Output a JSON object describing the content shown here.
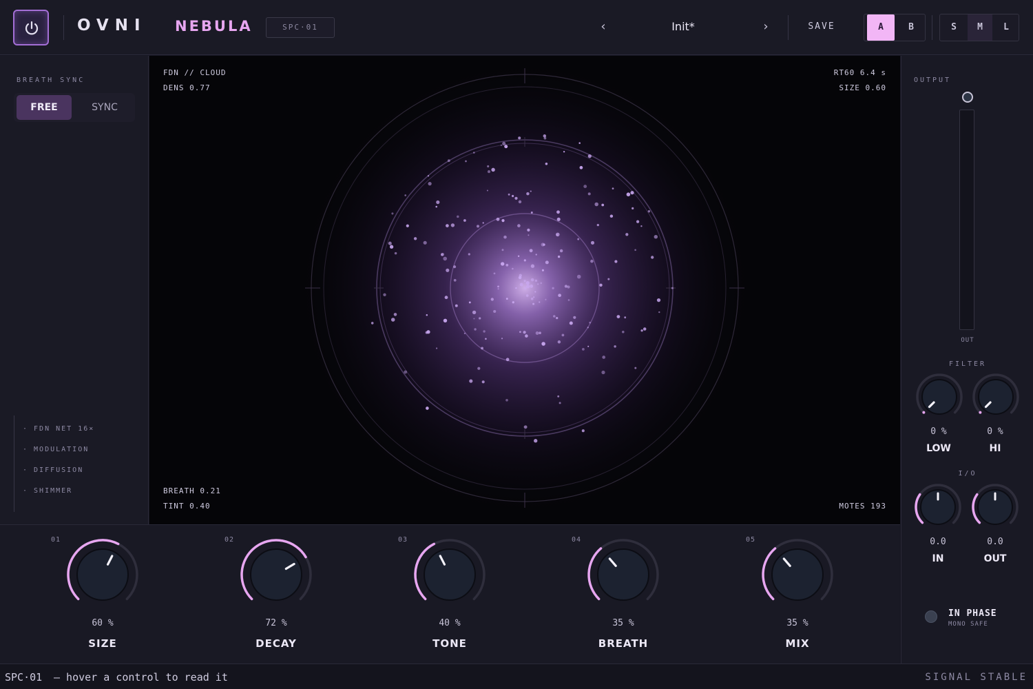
{
  "header": {
    "brand": "OVNI",
    "product": "NEBULA",
    "model": "SPC·01",
    "preset_prev": "‹",
    "preset_name": "Init*",
    "preset_next": "›",
    "save_label": "SAVE",
    "ab": [
      {
        "label": "A",
        "active": true
      },
      {
        "label": "B",
        "active": false
      }
    ],
    "sizes": [
      {
        "label": "S",
        "active": false
      },
      {
        "label": "M",
        "active": true
      },
      {
        "label": "L",
        "active": false
      }
    ]
  },
  "left": {
    "breath_sync_label": "BREATH SYNC",
    "free_label": "FREE",
    "sync_label": "SYNC",
    "mode": "FREE",
    "tags": [
      "· FDN NET 16×",
      "· MODULATION",
      "· DIFFUSION",
      "· SHIMMER"
    ]
  },
  "viz": {
    "top_left_1": "FDN // CLOUD",
    "top_left_2": "DENS 0.77",
    "top_right_1": "RT60 6.4 s",
    "top_right_2": "SIZE 0.60",
    "bottom_left_1": "BREATH 0.21",
    "bottom_left_2": "TINT 0.40",
    "bottom_right": "MOTES 193",
    "dens": 0.77,
    "motes": 193
  },
  "knobs": [
    {
      "index": "01",
      "value": 60,
      "value_text": "60 %",
      "label": "SIZE"
    },
    {
      "index": "02",
      "value": 72,
      "value_text": "72 %",
      "label": "DECAY"
    },
    {
      "index": "03",
      "value": 40,
      "value_text": "40 %",
      "label": "TONE"
    },
    {
      "index": "04",
      "value": 35,
      "value_text": "35 %",
      "label": "BREATH"
    },
    {
      "index": "05",
      "value": 35,
      "value_text": "35 %",
      "label": "MIX"
    }
  ],
  "right": {
    "output_label": "OUTPUT",
    "out_label": "OUT",
    "output_level": 0,
    "filter_label": "FILTER",
    "filter": [
      {
        "value": 0,
        "value_text": "0 %",
        "label": "LOW"
      },
      {
        "value": 0,
        "value_text": "0 %",
        "label": "HI"
      }
    ],
    "io_label": "I/O",
    "io": [
      {
        "value": 0.0,
        "value_text": "0.0",
        "label": "IN"
      },
      {
        "value": 0.0,
        "value_text": "0.0",
        "label": "OUT"
      }
    ],
    "phase_label": "IN PHASE",
    "phase_sub": "MONO SAFE"
  },
  "status": {
    "id": "SPC·01",
    "message": "—  hover a control to read it",
    "right": "SIGNAL STABLE"
  },
  "colors": {
    "accent": "#e7a6f0",
    "accent_bright": "#f2b6f6",
    "background": "#161621"
  }
}
